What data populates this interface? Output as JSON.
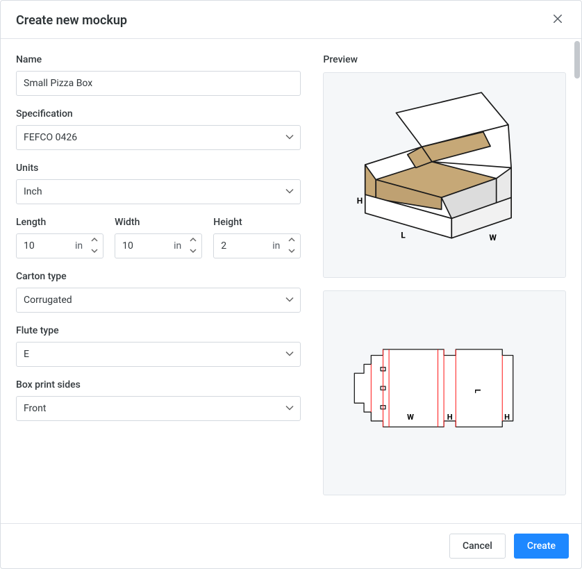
{
  "dialog": {
    "title": "Create new mockup"
  },
  "form": {
    "name": {
      "label": "Name",
      "value": "Small Pizza Box"
    },
    "specification": {
      "label": "Specification",
      "value": "FEFCO 0426"
    },
    "units": {
      "label": "Units",
      "value": "Inch",
      "abbrev": "in"
    },
    "dims": {
      "length": {
        "label": "Length",
        "value": "10"
      },
      "width": {
        "label": "Width",
        "value": "10"
      },
      "height": {
        "label": "Height",
        "value": "2"
      }
    },
    "carton_type": {
      "label": "Carton type",
      "value": "Corrugated"
    },
    "flute_type": {
      "label": "Flute type",
      "value": "E"
    },
    "print_sides": {
      "label": "Box print sides",
      "value": "Front"
    }
  },
  "preview": {
    "label": "Preview",
    "iso_labels": {
      "h": "H",
      "l": "L",
      "w": "W"
    },
    "flat_labels": {
      "w": "W",
      "h1": "H",
      "l": "L",
      "h2": "H"
    }
  },
  "footer": {
    "cancel": "Cancel",
    "create": "Create"
  }
}
